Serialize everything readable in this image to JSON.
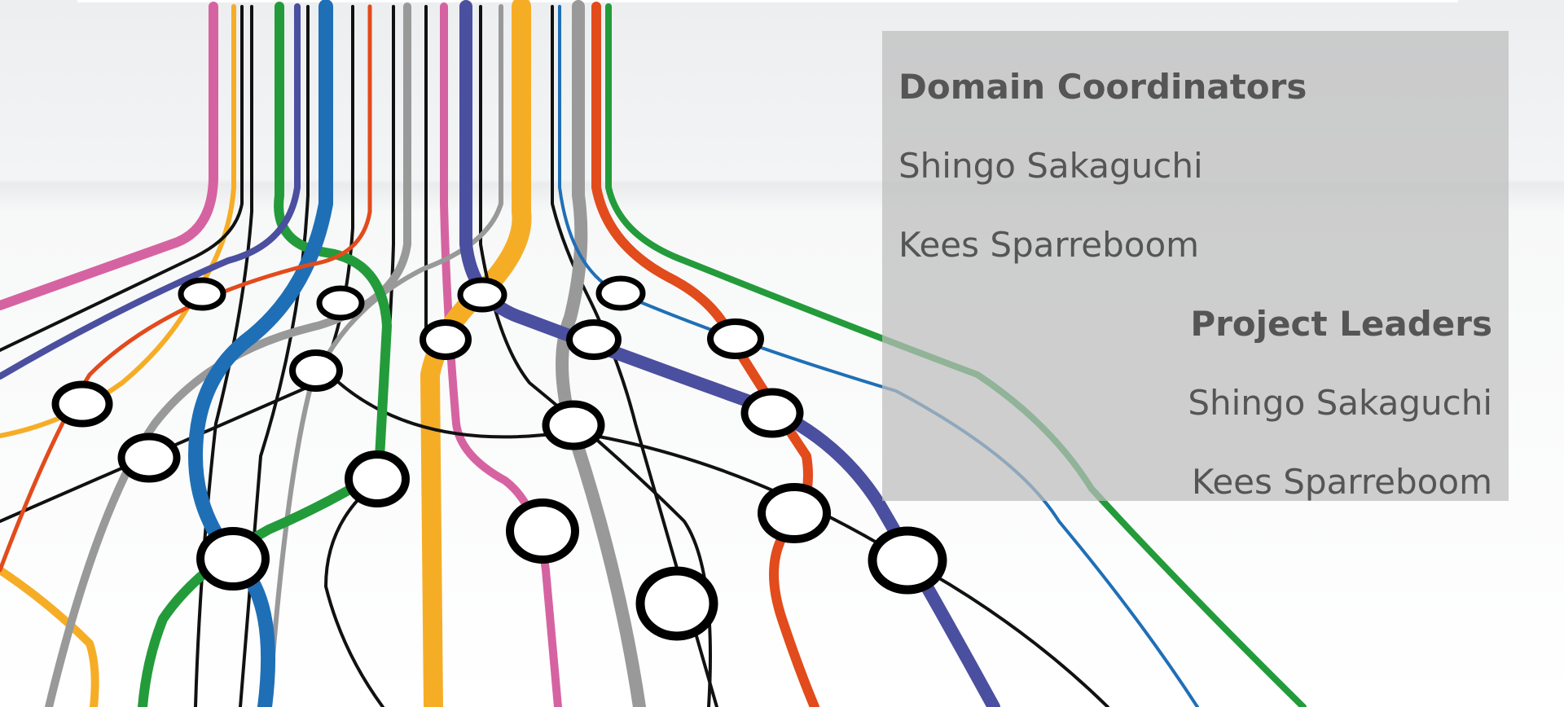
{
  "panel": {
    "section1": {
      "heading": "Domain Coordinators",
      "names": [
        "Shingo Sakaguchi",
        "Kees Sparreboom"
      ]
    },
    "section2": {
      "heading": "Project Leaders",
      "names": [
        "Shingo Sakaguchi",
        "Kees Sparreboom"
      ]
    }
  },
  "colors": {
    "panel_bg": "#bcbcbc",
    "panel_text": "#555555",
    "line_pink": "#d663a1",
    "line_yellow": "#f6ad26",
    "line_black": "#111111",
    "line_green": "#239b3a",
    "line_purple": "#4b4f9f",
    "line_blue": "#1f6fb6",
    "line_orange": "#e24b1c",
    "line_gray": "#999999"
  }
}
